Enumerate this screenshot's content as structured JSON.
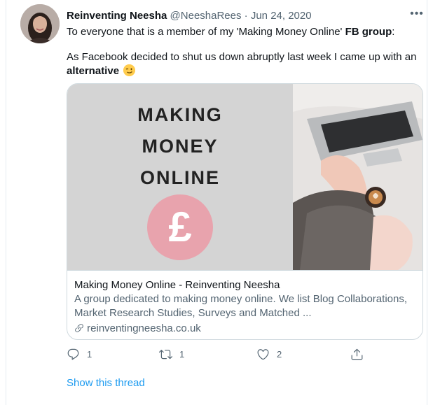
{
  "tweet": {
    "display_name": "Reinventing Neesha",
    "handle": "@NeeshaRees",
    "separator": "·",
    "date": "Jun 24, 2020",
    "line1_before": "To everyone that is a member of my 'Making Money Online' ",
    "line1_bold": "FB group",
    "line1_after": ":",
    "line2_before": "As Facebook decided to shut us down abruptly last week I came up with an ",
    "line2_bold": "alternative",
    "emoji_icon": "winking-face-icon",
    "more_label": "•••"
  },
  "card": {
    "image_title_lines": [
      "MAKING",
      "MONEY",
      "ONLINE"
    ],
    "pound_symbol": "£",
    "title": "Making Money Online - Reinventing Neesha",
    "description": "A group dedicated to making money online. We list Blog Collaborations, Market Research Studies, Surveys and Matched ...",
    "domain": "reinventingneesha.co.uk"
  },
  "actions": {
    "reply_count": "1",
    "retweet_count": "1",
    "like_count": "2"
  },
  "show_thread": "Show this thread",
  "colors": {
    "link_blue": "#1d9bf0",
    "muted_gray": "#536471",
    "card_border": "#cfd9de",
    "pound_pink": "#e8a3ad"
  }
}
